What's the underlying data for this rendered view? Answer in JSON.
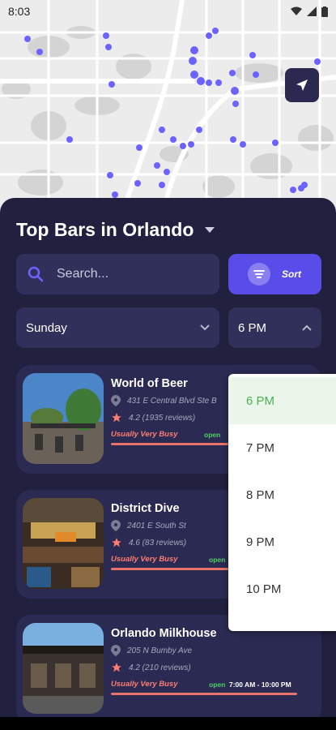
{
  "status_bar": {
    "time": "8:03"
  },
  "map": {
    "pin_color": "#6c63ff",
    "background": "#ececec"
  },
  "header": {
    "title": "Top Bars in Orlando"
  },
  "search": {
    "placeholder": "Search..."
  },
  "sort": {
    "label": "Sort"
  },
  "filters": {
    "day": "Sunday",
    "time": "6 PM"
  },
  "time_dropdown": {
    "options": [
      "6 PM",
      "7 PM",
      "8 PM",
      "9 PM",
      "10 PM"
    ],
    "selected": "6 PM"
  },
  "bars": [
    {
      "name": "World of Beer",
      "address": "431 E Central Blvd Ste B",
      "rating": "4.2 (1935 reviews)",
      "busyness": "Usually Very Busy",
      "status": "open",
      "hours": ""
    },
    {
      "name": "District Dive",
      "address": "2401 E South St",
      "rating": "4.6 (83 reviews)",
      "busyness": "Usually Very Busy",
      "status": "open",
      "hours": ""
    },
    {
      "name": "Orlando Milkhouse",
      "address": "205 N Bumby Ave",
      "rating": "4.2 (210 reviews)",
      "busyness": "Usually Very Busy",
      "status": "open",
      "hours": "7:00 AM - 10:00 PM"
    }
  ],
  "icons": {
    "search": "search-icon",
    "dropdown": "chevron-down-icon",
    "sort": "filter-icon",
    "location": "map-pin-icon",
    "rating": "star-icon",
    "navigate": "navigation-arrow-icon"
  },
  "colors": {
    "accent": "#5a4ce8",
    "busy": "#ff7e72",
    "open": "#4ed166",
    "star": "#ff7e72"
  }
}
